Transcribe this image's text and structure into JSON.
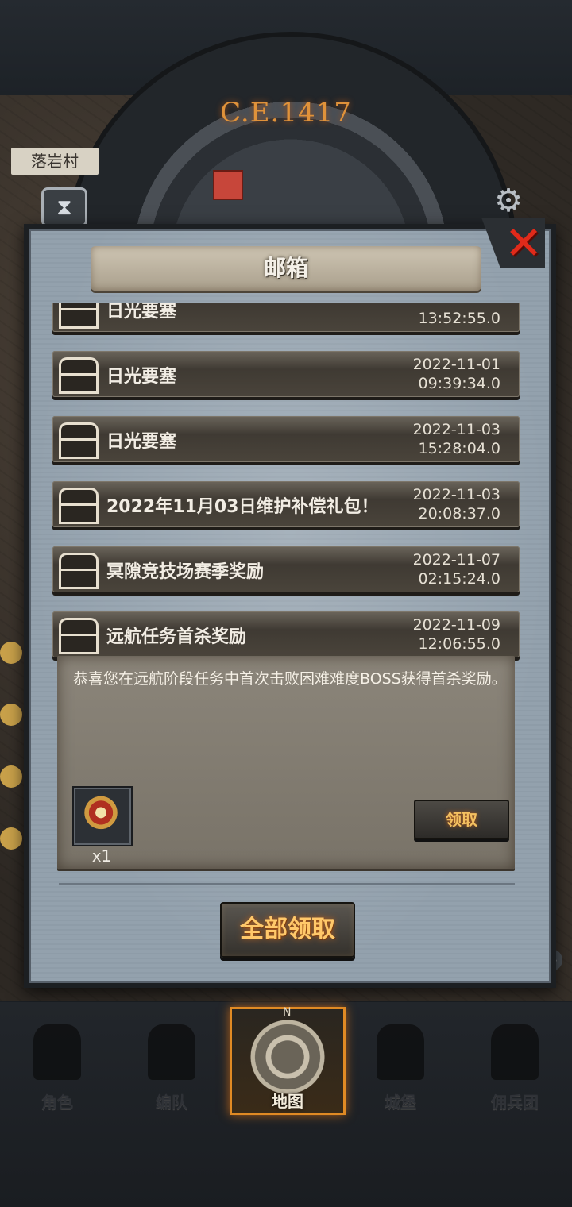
{
  "background": {
    "year": "C.E.1417",
    "village": "落岩村"
  },
  "modal": {
    "title": "邮箱",
    "close_icon": "close-x-icon",
    "mails": [
      {
        "title": "日光要塞",
        "date": "",
        "time": "13:52:55.0"
      },
      {
        "title": "日光要塞",
        "date": "2022-11-01",
        "time": "09:39:34.0"
      },
      {
        "title": "日光要塞",
        "date": "2022-11-03",
        "time": "15:28:04.0"
      },
      {
        "title": "2022年11月03日维护补偿礼包！",
        "date": "2022-11-03",
        "time": "20:08:37.0"
      },
      {
        "title": "冥隙竞技场赛季奖励",
        "date": "2022-11-07",
        "time": "02:15:24.0"
      },
      {
        "title": "远航任务首杀奖励",
        "date": "2022-11-09",
        "time": "12:06:55.0"
      }
    ],
    "detail": {
      "text": "恭喜您在远航阶段任务中首次击败困难难度BOSS获得首杀奖励。",
      "reward_count": "x1",
      "claim_label": "领取"
    },
    "claim_all_label": "全部领取"
  },
  "nav": {
    "items": [
      {
        "label": "角色",
        "icon": "knight-icon"
      },
      {
        "label": "编队",
        "icon": "formation-icon"
      },
      {
        "label": "地图",
        "icon": "compass-icon",
        "active": true
      },
      {
        "label": "城堡",
        "icon": "castle-icon"
      },
      {
        "label": "佣兵团",
        "icon": "mercenary-icon"
      }
    ]
  },
  "colors": {
    "accent_orange": "#e08a24",
    "close_red": "#e02a1a",
    "modal_bg": "#93a1ad"
  }
}
